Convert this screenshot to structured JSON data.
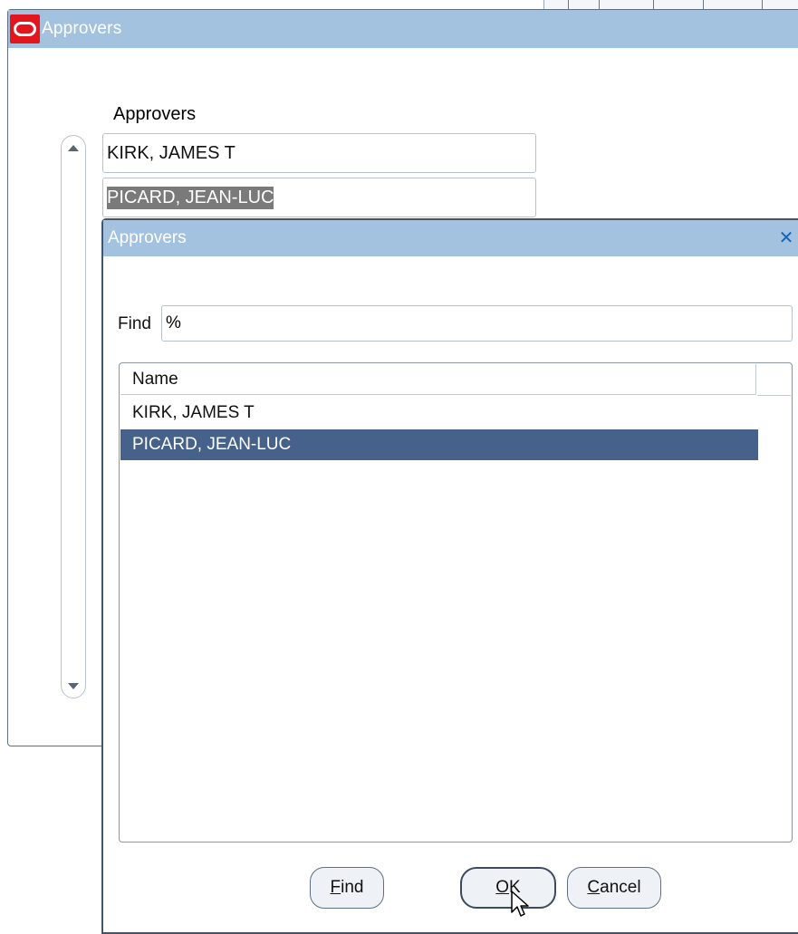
{
  "main_window": {
    "title": "Approvers",
    "field_label": "Approvers",
    "records": [
      {
        "value": "KIRK, JAMES T"
      },
      {
        "value": "PICARD, JEAN-LUC"
      }
    ]
  },
  "lov_dialog": {
    "title": "Approvers",
    "find_label": "Find",
    "find_value": "%",
    "column_header": "Name",
    "results": [
      {
        "name": "KIRK, JAMES T",
        "selected": false
      },
      {
        "name": "PICARD, JEAN-LUC",
        "selected": true
      }
    ],
    "buttons": {
      "find": {
        "mnemonic": "F",
        "rest": "ind"
      },
      "ok": {
        "mnemonic": "O",
        "rest": "K"
      },
      "cancel": {
        "mnemonic": "C",
        "rest": "ancel"
      }
    }
  },
  "colors": {
    "title_bar": "#a3c2df",
    "selected_row": "#46618a",
    "oracle_red": "#e3161e",
    "close_icon": "#1a63b8"
  },
  "icons": [
    "oracle-logo-icon",
    "scroll-up-icon",
    "scroll-down-icon",
    "close-icon",
    "mouse-pointer-icon"
  ]
}
